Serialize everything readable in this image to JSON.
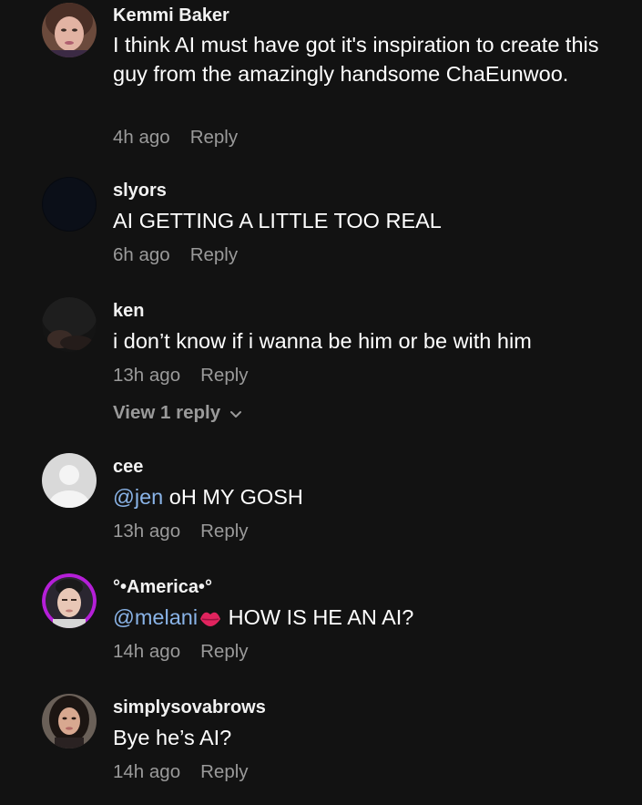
{
  "comments": [
    {
      "username": "Kemmi Baker",
      "text": "I think AI must have got it's inspiration to create this guy from the amazingly handsome ChaEunwoo.",
      "time": "4h ago",
      "reply": "Reply",
      "avatar": "photo-woman-icon"
    },
    {
      "username": "slyors",
      "text": "AI GETTING A LITTLE TOO REAL",
      "time": "6h ago",
      "reply": "Reply",
      "avatar": "dark-avatar-icon"
    },
    {
      "username": "ken",
      "text": "i don’t know if i wanna be him or be with him",
      "time": "13h ago",
      "reply": "Reply",
      "view_replies": "View 1 reply",
      "avatar": "dark-photo-icon"
    },
    {
      "username": "cee",
      "mention": "@jen",
      "text": " oH MY GOSH",
      "time": "13h ago",
      "reply": "Reply",
      "avatar": "default-user-icon"
    },
    {
      "username": "°•America•°",
      "mention": "@melani",
      "text": " HOW IS HE AN AI?",
      "emoji": "kiss-lips-icon",
      "time": "14h ago",
      "reply": "Reply",
      "avatar": "photo-man-purple-ring-icon"
    },
    {
      "username": "simplysovabrows",
      "text": "Bye he’s AI?",
      "time": "14h ago",
      "reply": "Reply",
      "avatar": "photo-woman-dark-hair-icon"
    }
  ],
  "colors": {
    "background": "#121212",
    "mention": "#8ab4e8",
    "meta": "#9a9a9a",
    "text": "#ffffff"
  }
}
